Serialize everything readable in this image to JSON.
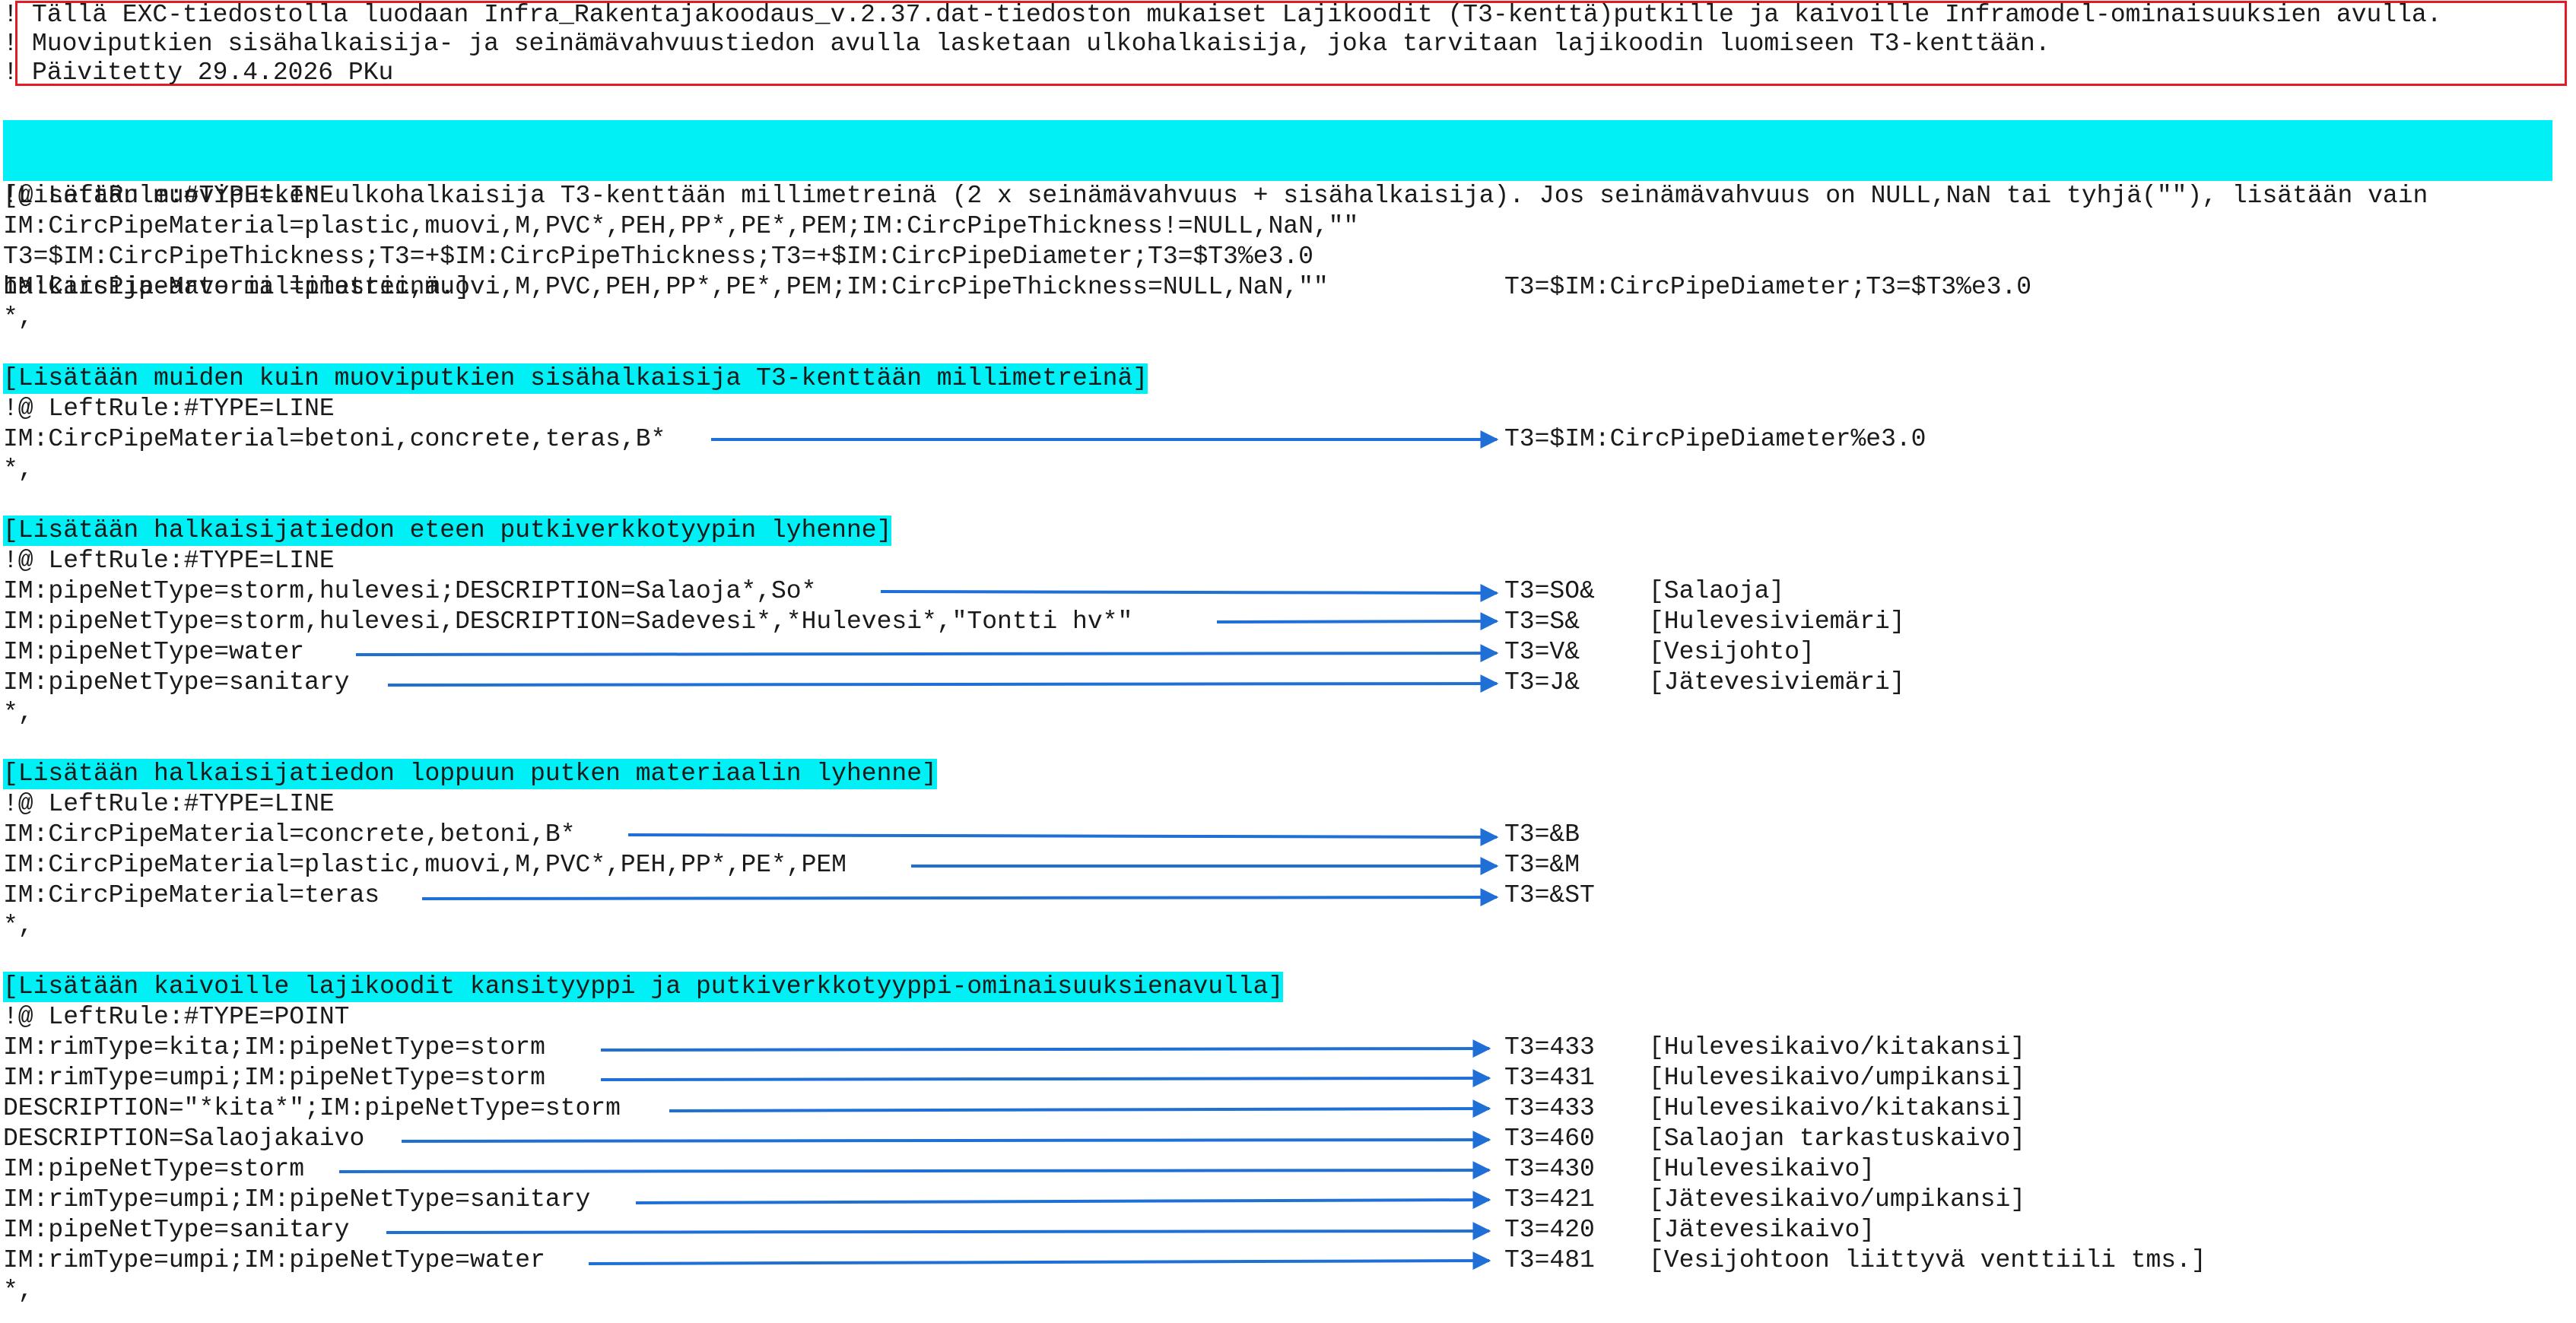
{
  "header": {
    "bang": "!",
    "lines": [
      "Tällä EXC-tiedostolla luodaan Infra_Rakentajakoodaus_v.2.37.dat-tiedoston mukaiset Lajikoodit (T3-kenttä)putkille ja kaivoille Inframodel-ominaisuuksien avulla.",
      "Muoviputkien sisähalkaisija- ja seinämävahvuustiedon avulla lasketaan ulkohalkaisija, joka tarvitaan lajikoodin luomiseen T3-kenttään.",
      "Päivitetty 29.4.2026 PKu"
    ]
  },
  "section1": {
    "comment_line1": "[Lisätään muoviputken ulkohalkaisija T3-kenttään millimetreinä (2 x seinämävahvuus + sisähalkaisija). Jos seinämävahvuus on NULL,NaN tai tyhjä(\"\"), lisätään vain",
    "comment_line2": "halkaisija-arvo millimetreinä.]",
    "rule": "!@ LeftRule:#TYPE=LINE",
    "line1": "IM:CircPipeMaterial=plastic,muovi,M,PVC*,PEH,PP*,PE*,PEM;IM:CircPipeThickness!=NULL,NaN,\"\"",
    "line2": "T3=$IM:CircPipeThickness;T3=+$IM:CircPipeThickness;T3=+$IM:CircPipeDiameter;T3=$T3%e3.0",
    "line3": "IM:CircPipeMaterial=plastic,muovi,M,PVC,PEH,PP*,PE*,PEM;IM:CircPipeThickness=NULL,NaN,\"\"",
    "line3_result": "T3=$IM:CircPipeDiameter;T3=$T3%e3.0",
    "end": "*,"
  },
  "section2": {
    "comment": "[Lisätään muiden kuin muoviputkien sisähalkaisija T3-kenttään millimetreinä]",
    "rule": "!@ LeftRule:#TYPE=LINE",
    "rules": [
      {
        "condition": "IM:CircPipeMaterial=betoni,concrete,teras,B*",
        "result": "T3=$IM:CircPipeDiameter%e3.0",
        "comment": ""
      }
    ],
    "end": "*,"
  },
  "section3": {
    "comment": "[Lisätään halkaisijatiedon eteen putkiverkkotyypin lyhenne]",
    "rule": "!@ LeftRule:#TYPE=LINE",
    "rules": [
      {
        "condition": "IM:pipeNetType=storm,hulevesi;DESCRIPTION=Salaoja*,So*",
        "result": "T3=SO&",
        "comment": "[Salaoja]"
      },
      {
        "condition": "IM:pipeNetType=storm,hulevesi,DESCRIPTION=Sadevesi*,*Hulevesi*,\"Tontti hv*\"",
        "result": "T3=S&",
        "comment": "[Hulevesiviemäri]"
      },
      {
        "condition": "IM:pipeNetType=water",
        "result": "T3=V&",
        "comment": "[Vesijohto]"
      },
      {
        "condition": "IM:pipeNetType=sanitary",
        "result": "T3=J&",
        "comment": "[Jätevesiviemäri]"
      }
    ],
    "end": "*,"
  },
  "section4": {
    "comment": "[Lisätään halkaisijatiedon loppuun putken materiaalin lyhenne]",
    "rule": "!@ LeftRule:#TYPE=LINE",
    "rules": [
      {
        "condition": "IM:CircPipeMaterial=concrete,betoni,B*",
        "result": "T3=&B",
        "comment": ""
      },
      {
        "condition": "IM:CircPipeMaterial=plastic,muovi,M,PVC*,PEH,PP*,PE*,PEM",
        "result": "T3=&M",
        "comment": ""
      },
      {
        "condition": "IM:CircPipeMaterial=teras",
        "result": "T3=&ST",
        "comment": ""
      }
    ],
    "end": "*,"
  },
  "section5": {
    "comment": "[Lisätään kaivoille lajikoodit kansityyppi ja putkiverkkotyyppi-ominaisuuksienavulla]",
    "rule": "!@ LeftRule:#TYPE=POINT",
    "rules": [
      {
        "condition": "IM:rimType=kita;IM:pipeNetType=storm",
        "result": "T3=433",
        "comment": "[Hulevesikaivo/kitakansi]"
      },
      {
        "condition": "IM:rimType=umpi;IM:pipeNetType=storm",
        "result": "T3=431",
        "comment": "[Hulevesikaivo/umpikansi]"
      },
      {
        "condition": "DESCRIPTION=\"*kita*\";IM:pipeNetType=storm",
        "result": "T3=433",
        "comment": "[Hulevesikaivo/kitakansi]"
      },
      {
        "condition": "DESCRIPTION=Salaojakaivo",
        "result": "T3=460",
        "comment": "[Salaojan tarkastuskaivo]"
      },
      {
        "condition": "IM:pipeNetType=storm",
        "result": "T3=430",
        "comment": "[Hulevesikaivo]"
      },
      {
        "condition": "IM:rimType=umpi;IM:pipeNetType=sanitary",
        "result": "T3=421",
        "comment": "[Jätevesikaivo/umpikansi]"
      },
      {
        "condition": "IM:pipeNetType=sanitary",
        "result": "T3=420",
        "comment": "[Jätevesikaivo]"
      },
      {
        "condition": "IM:rimType=umpi;IM:pipeNetType=water",
        "result": "T3=481",
        "comment": "[Vesijohtoon liittyvä venttiili tms.]"
      }
    ],
    "end": "*,"
  },
  "colors": {
    "highlight": "#00f0f6",
    "header_border": "#e21c24",
    "arrow": "#1f6fd6",
    "text": "#1a1a1a"
  }
}
